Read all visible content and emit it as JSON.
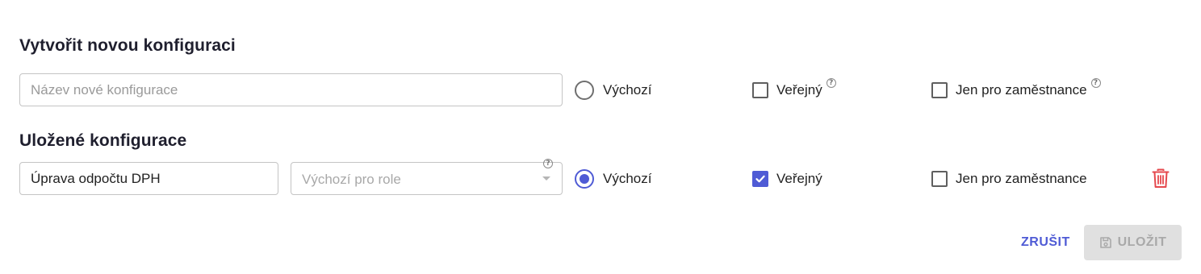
{
  "new_config": {
    "title": "Vytvořit novou konfiguraci",
    "name_placeholder": "Název nové konfigurace",
    "default_label": "Výchozí",
    "public_label": "Veřejný",
    "employees_only_label": "Jen pro zaměstnance",
    "help_glyph": "?"
  },
  "saved_configs": {
    "title": "Uložené konfigurace",
    "items": [
      {
        "name": "Úprava odpočtu DPH",
        "roles_placeholder": "Výchozí pro role",
        "default_label": "Výchozí",
        "default_checked": true,
        "public_label": "Veřejný",
        "public_checked": true,
        "employees_only_label": "Jen pro zaměstnance",
        "employees_only_checked": false
      }
    ]
  },
  "actions": {
    "cancel_label": "ZRUŠIT",
    "save_label": "ULOŽIT",
    "save_disabled": true
  },
  "colors": {
    "accent": "#4f5bd5",
    "danger": "#e5484d",
    "disabled_bg": "#e0e0e0"
  },
  "icons": [
    "help-icon",
    "check-icon",
    "trash-icon",
    "save-icon"
  ]
}
